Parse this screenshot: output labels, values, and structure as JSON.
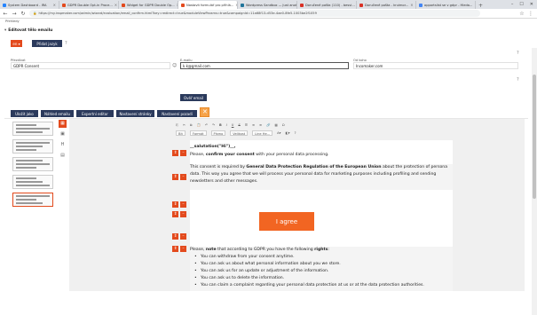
{
  "browser": {
    "tabs": [
      {
        "title": "System Dashboard - IRA",
        "color": "#2684ff"
      },
      {
        "title": "GDPR Double Opt-in Proce...",
        "color": "#e34a1d"
      },
      {
        "title": "Widget for GDPR Double Op...",
        "color": "#e34a1d"
      },
      {
        "title": "Nastavit formulář pro přihlá...",
        "color": "#e34a1d"
      },
      {
        "title": "Wordpress Sandbox — Just anoth...",
        "color": "#21759b"
      },
      {
        "title": "Doručené pošta (110) - besvi...",
        "color": "#d93025"
      },
      {
        "title": "Doručené pošta - kruimor...",
        "color": "#d93025"
      },
      {
        "title": "opportslist se v gdpr - Hleda...",
        "color": "#4285f4"
      }
    ],
    "url": "https://my.inspmaker.com/admin/wizard/evaluation/email_confirm.html?key=redirect=true&moduleViewParams=true&campaignId=11a68f13-d53e-4ae0-8fe5-1003be2f1059",
    "bookmarks": "Přehledy"
  },
  "section": {
    "title": "Editovat tělo emailu"
  },
  "language": {
    "current": "en",
    "add_label": "Přidat jazyk"
  },
  "fields": {
    "sender_label": "Přezdívat",
    "sender_value": "GDPR Consent",
    "email_label": "E-mailu",
    "email_value": "k.k@gmail.com",
    "from_label": "Od koho",
    "from_value": "Incomaker.com",
    "verify_label": "Ověř email"
  },
  "toolbar_buttons": [
    "Uložit jako",
    "Náhled emailu",
    "Expertní editor",
    "Nastavení stránky",
    "Nastavení pozadí"
  ],
  "editor_toolbar": {
    "font": "Bit",
    "format": "Formát",
    "size": "Písmo",
    "weight": "Velikost",
    "line": "Line He..."
  },
  "content": {
    "salutation": "__salutation(\"Hi\")__,",
    "confirm_pre": "Please, ",
    "confirm_bold": "confirm your consent",
    "confirm_post": " with your personal data processing.",
    "consent_pre": "This consent is required by ",
    "consent_bold": "General Data Protection Regulation of the European Union",
    "consent_post": " about the protection of persona data. This way you agree that we will process your personal data for marketing purposes including profiling and sending newsletters and other messages.",
    "agree_button": "I agree",
    "rights_pre": "Please, ",
    "rights_note": "note",
    "rights_mid": " that according to GDPR you have the following ",
    "rights_bold": "rights",
    "rights_post": ":",
    "rights": [
      "You can withdraw from your consent anytime.",
      "You can ask us about what personal information about you we store.",
      "You can ask us for an update or adjustment of the information.",
      "You can ask us to delete the information.",
      "You can claim a complaint regarding your personal data protection at us or at the data protection authorities."
    ]
  }
}
